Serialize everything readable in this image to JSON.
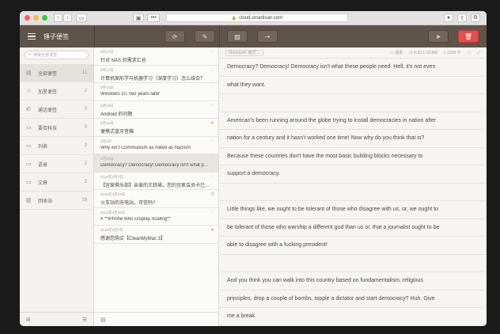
{
  "browser": {
    "url": "cloud.smartisan.com",
    "colors": {
      "close": "#fc605c",
      "minimize": "#fdbc40",
      "maximize": "#34c84a"
    }
  },
  "app": {
    "title": "锤子便签"
  },
  "sidebar": {
    "search_placeholder": "搜索全部便签",
    "categories": [
      {
        "label": "全部便签",
        "count": "11",
        "icon": "document-icon"
      },
      {
        "label": "加星便签",
        "count": "2",
        "icon": "star-outline-icon"
      },
      {
        "label": "通话便签",
        "count": "0",
        "icon": "phone-icon"
      },
      {
        "label": "要否科技",
        "count": "0",
        "icon": "folder-icon"
      },
      {
        "label": "列表",
        "count": "2",
        "icon": "folder-icon"
      },
      {
        "label": "语录",
        "count": "2",
        "icon": "folder-icon"
      },
      {
        "label": "文章",
        "count": "2",
        "icon": "folder-icon"
      },
      {
        "label": "回收站",
        "count": "39",
        "icon": "trash-icon"
      }
    ]
  },
  "notes": [
    {
      "date": "6月17日",
      "title": "针对 NAS 的需求汇总",
      "star": false
    },
    {
      "date": "6月17日",
      "title": "计算机图形学与机器学习（深度学习）怎么结合？",
      "star": false
    },
    {
      "date": "6月14日",
      "title": "Windows 10, two years later",
      "star": false
    },
    {
      "date": "5月23日",
      "title": "Android 的问题",
      "star": false
    },
    {
      "date": "5月16日",
      "title": "便携式蓝牙音箱",
      "star": true
    },
    {
      "date": "5月2日",
      "title": "Why isn't Communism as hated as Nazism",
      "star": false
    },
    {
      "date": "4月20日",
      "title": "Democracy? Democracy! Democracy isn't what people need.",
      "star": false
    },
    {
      "date": "2016年7月7日",
      "title": "【宜家俱乐部】亲爱的王跃珺，您的宜家会员卡已激活",
      "star": false
    },
    {
      "date": "2016年3月29日",
      "title": "火车站的充电站，可信吗?",
      "star": false,
      "mini": true
    },
    {
      "date": "2016年3月28日",
      "title": "# **iPhone 6/6s Display Scaling**",
      "star": false
    },
    {
      "date": "2016年3月7日",
      "title": "感谢您购买【CleanMyMac 3】",
      "star": true
    }
  ],
  "editor": {
    "format": "Markdown 格式",
    "category": "语录",
    "datetime": "4-20 1:18 AM",
    "wordcount": "1034 字",
    "lines": [
      "Democracy? Democracy! Democracy isn't what these people need. Hell, it's not even",
      "what they want.",
      "",
      "American's been running around the globe trying to install democracies in nation after",
      "nation for a century and it hasn't worked one time! Now why do you think that is?",
      "Because these countries don't have the most basic building blocks necessary to",
      "support a democracy.",
      "",
      "Little things like, we ought to be tolerant of those who disagree with us, or, we ought to",
      "be tolerant of those who warship a different god than us or, that a journalist ought to be",
      "able to disagree with a fucking president!",
      "",
      "And you think you can walk into this country based on fundamentalism, religious",
      "principles, drop a couple of bombs, topple a dictator and start democracy? Huh. Give",
      "me a break."
    ]
  }
}
